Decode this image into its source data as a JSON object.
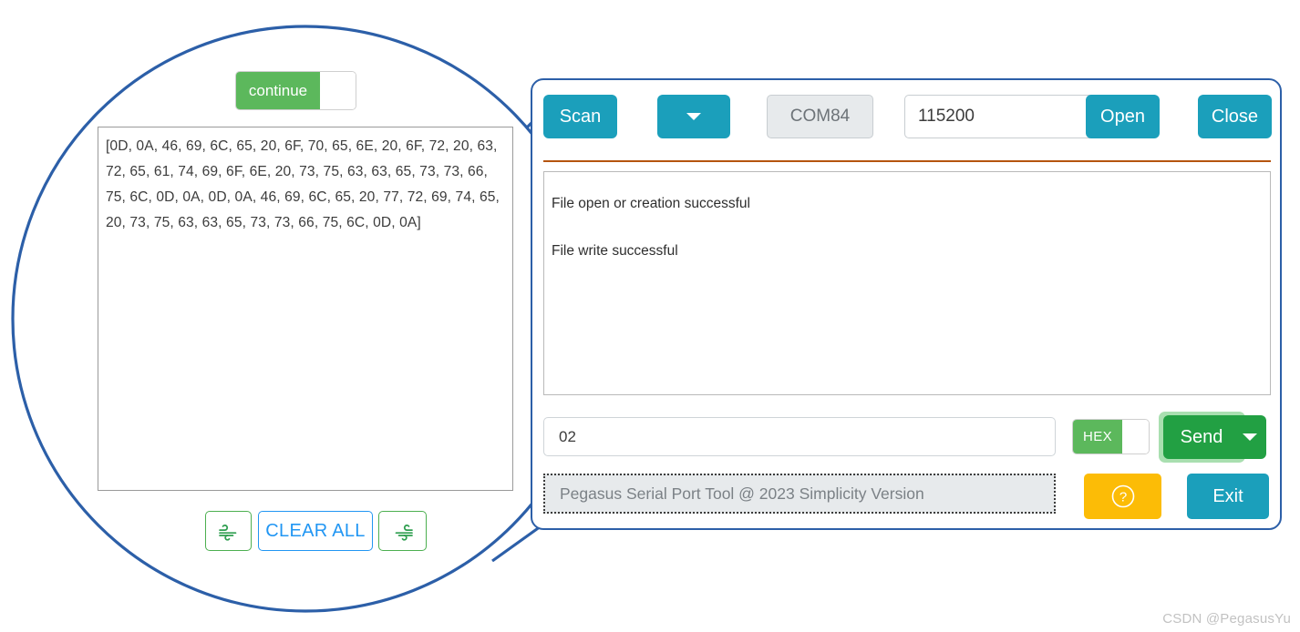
{
  "zoom_region": {
    "continue_toggle": {
      "label": "continue",
      "state_on": true,
      "on_color": "#5cb85c"
    },
    "receive_textarea": {
      "value": "[0D, 0A, 46, 69, 6C, 65, 20, 6F, 70, 65, 6E, 20, 6F, 72, 20, 63, 72, 65, 61, 74, 69, 6F, 6E, 20, 73, 75, 63, 63, 65, 73, 73, 66, 75, 6C, 0D, 0A, 0D, 0A, 46, 69, 6C, 65, 20, 77, 72, 69, 74, 65, 20, 73, 75, 63, 63, 65, 73, 73, 66, 75, 6C, 0D, 0A]"
    },
    "buttons": {
      "clear_receive_icon": "wind-icon",
      "clear_all_label": "CLEAR ALL",
      "clear_send_icon": "wind-icon",
      "clear_all_color": "#2196f3",
      "icon_color": "#4caf50"
    }
  },
  "app_panel": {
    "accent_color": "#1b9fbb",
    "border_color": "#2c5fa8",
    "divider_color": "#b5540f",
    "toolbar": {
      "scan_label": "Scan",
      "scan_dropdown_icon": "chevron-down-icon",
      "port_value": "COM84",
      "baud_value": "115200",
      "baud_dropdown_icon": "chevron-down-icon",
      "open_label": "Open",
      "close_label": "Close"
    },
    "log": {
      "lines": [
        "File open or creation successful",
        "File write successful"
      ]
    },
    "send_row": {
      "input_value": "02",
      "hex_toggle_label": "HEX",
      "hex_toggle_on": true,
      "hex_on_color": "#5cb85c",
      "send_label": "Send",
      "send_color": "#22a043",
      "send_dropdown_icon": "chevron-down-icon"
    },
    "footer": {
      "status_text": "Pegasus Serial Port Tool @ 2023 Simplicity Version",
      "help_icon": "question-circle-icon",
      "help_color": "#fcbc06",
      "exit_label": "Exit"
    }
  },
  "watermark": {
    "text": "CSDN @PegasusYu"
  }
}
